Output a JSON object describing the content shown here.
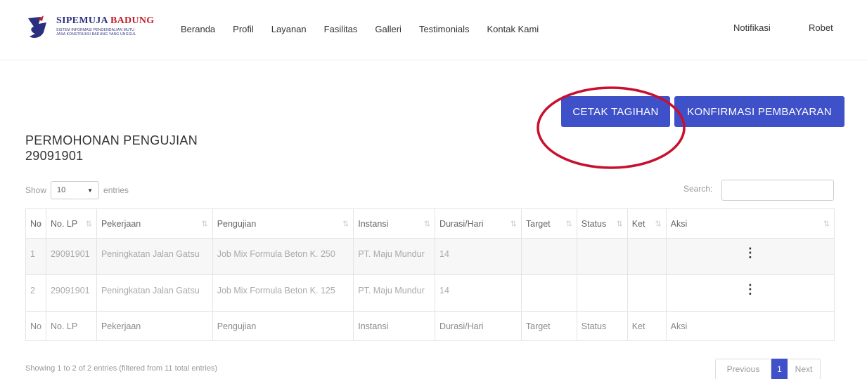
{
  "logo": {
    "title_main": "SIPEMUJA ",
    "title_accent": "BADUNG",
    "subtitle_line1": "SISTEM INFORMASI PENGENDALIAN MUTU",
    "subtitle_line2": "JASA KONSTRUKSI BADUNG YANG UNGGUL"
  },
  "nav": {
    "items": [
      "Beranda",
      "Profil",
      "Layanan",
      "Fasilitas",
      "Galleri",
      "Testimonials",
      "Kontak Kami"
    ],
    "notifications": "Notifikasi",
    "user": "Robet"
  },
  "actions": {
    "cetak_tagihan": "CETAK TAGIHAN",
    "konfirmasi_pembayaran": "KONFIRMASI PEMBAYARAN"
  },
  "page": {
    "title": "PERMOHONAN PENGUJIAN",
    "code": "29091901"
  },
  "controls": {
    "show_label": "Show",
    "page_length": "10",
    "entries_label": "entries",
    "search_label": "Search:",
    "search_value": ""
  },
  "table": {
    "columns": [
      "No",
      "No. LP",
      "Pekerjaan",
      "Pengujian",
      "Instansi",
      "Durasi/Hari",
      "Target",
      "Status",
      "Ket",
      "Aksi"
    ],
    "rows": [
      {
        "no": "1",
        "no_lp": "29091901",
        "pekerjaan": "Peningkatan Jalan Gatsu",
        "pengujian": "Job Mix Formula Beton K. 250",
        "instansi": "PT. Maju Mundur",
        "durasi": "14",
        "target": "",
        "status": "",
        "ket": ""
      },
      {
        "no": "2",
        "no_lp": "29091901",
        "pekerjaan": "Peningkatan Jalan Gatsu",
        "pengujian": "Job Mix Formula Beton K. 125",
        "instansi": "PT. Maju Mundur",
        "durasi": "14",
        "target": "",
        "status": "",
        "ket": ""
      }
    ]
  },
  "footer": {
    "info": "Showing 1 to 2 of 2 entries (filtered from 11 total entries)",
    "previous": "Previous",
    "current_page": "1",
    "next": "Next"
  },
  "colors": {
    "primary": "#3f51c8",
    "annotation": "#c8102e",
    "brand_navy": "#2a2f7f",
    "brand_red": "#c0202a"
  }
}
